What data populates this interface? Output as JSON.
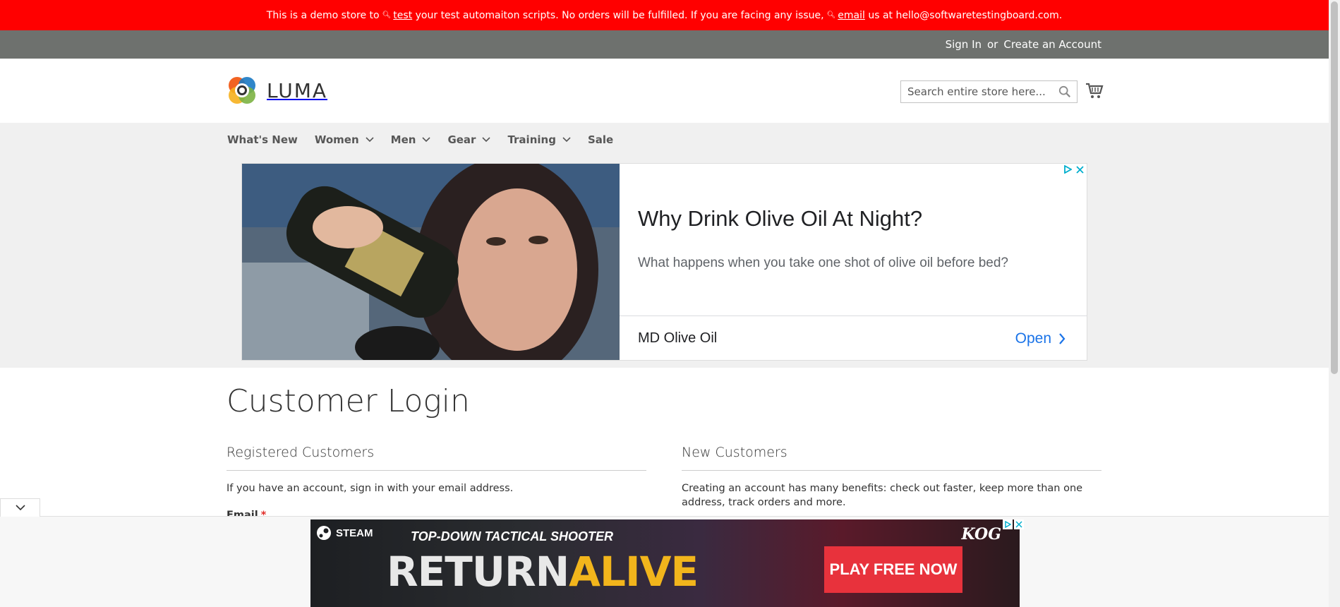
{
  "demo_notice": {
    "part1": "This is a demo store to",
    "link1": "test",
    "part2": "your test automaiton scripts. No orders will be fulfilled. If you are facing any issue,",
    "link2": "email",
    "part3": "us at hello@softwaretestingboard.com."
  },
  "top_links": {
    "sign_in": "Sign In",
    "or": "or",
    "create_account": "Create an Account"
  },
  "header": {
    "logo_text": "LUMA",
    "search_placeholder": "Search entire store here..."
  },
  "nav": {
    "items": [
      {
        "label": "What's New",
        "dropdown": false
      },
      {
        "label": "Women",
        "dropdown": true
      },
      {
        "label": "Men",
        "dropdown": true
      },
      {
        "label": "Gear",
        "dropdown": true
      },
      {
        "label": "Training",
        "dropdown": true
      },
      {
        "label": "Sale",
        "dropdown": false
      }
    ]
  },
  "ad": {
    "title": "Why Drink Olive Oil At Night?",
    "description": "What happens when you take one shot of olive oil before bed?",
    "brand": "MD Olive Oil",
    "cta": "Open"
  },
  "main": {
    "page_title": "Customer Login",
    "registered": {
      "title": "Registered Customers",
      "text": "If you have an account, sign in with your email address.",
      "email_label": "Email",
      "required_mark": "*"
    },
    "new_customers": {
      "title": "New Customers",
      "text": "Creating an account has many benefits: check out faster, keep more than one address, track orders and more."
    }
  },
  "bottom_ad": {
    "platform": "STEAM",
    "subtitle": "TOP-DOWN TACTICAL SHOOTER",
    "title_part1": "RETURN",
    "title_part2": "ALIVE",
    "cta": "PLAY FREE NOW",
    "publisher": "KOG"
  },
  "colors": {
    "demo_bar": "#ff0000",
    "top_links_bar": "#6e716e",
    "nav_bg": "#f0f0f0",
    "ad_link": "#1a73e8",
    "required": "#e02b27"
  }
}
